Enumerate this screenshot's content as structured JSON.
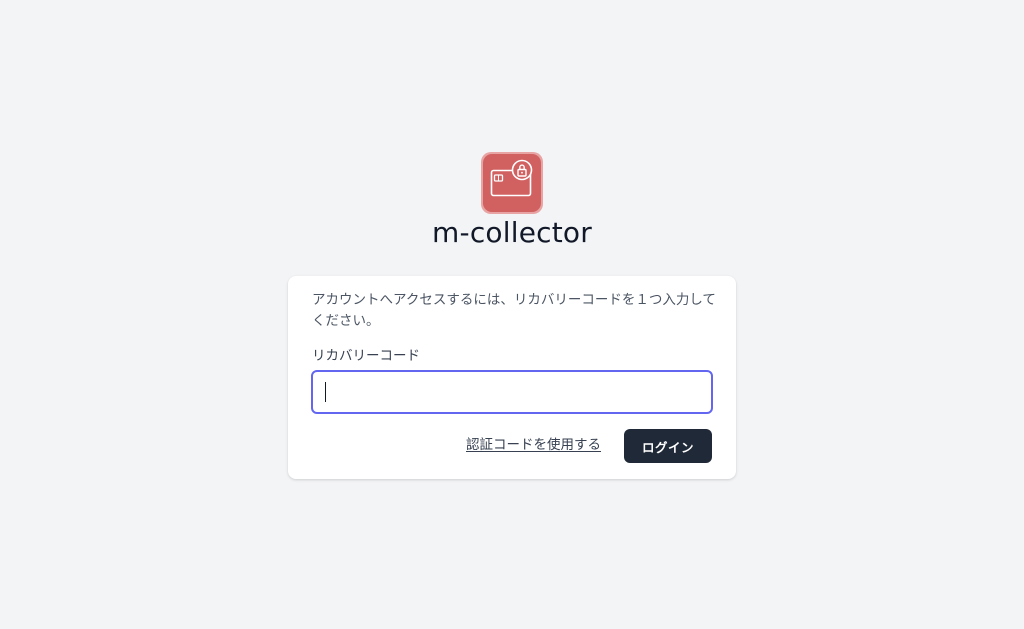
{
  "app": {
    "name": "m-collector",
    "logo_icon": "card-lock-icon",
    "logo_color": "#d16060"
  },
  "login": {
    "instructions": "アカウントへアクセスするには、リカバリーコードを１つ入力してください。",
    "recovery_code_label": "リカバリーコード",
    "recovery_code_value": "",
    "recovery_code_placeholder": "",
    "use_auth_code_link": "認証コードを使用する",
    "login_button": "ログイン"
  },
  "colors": {
    "background": "#f3f4f6",
    "card": "#ffffff",
    "focus_ring": "#6366f1",
    "button": "#1f2937"
  }
}
